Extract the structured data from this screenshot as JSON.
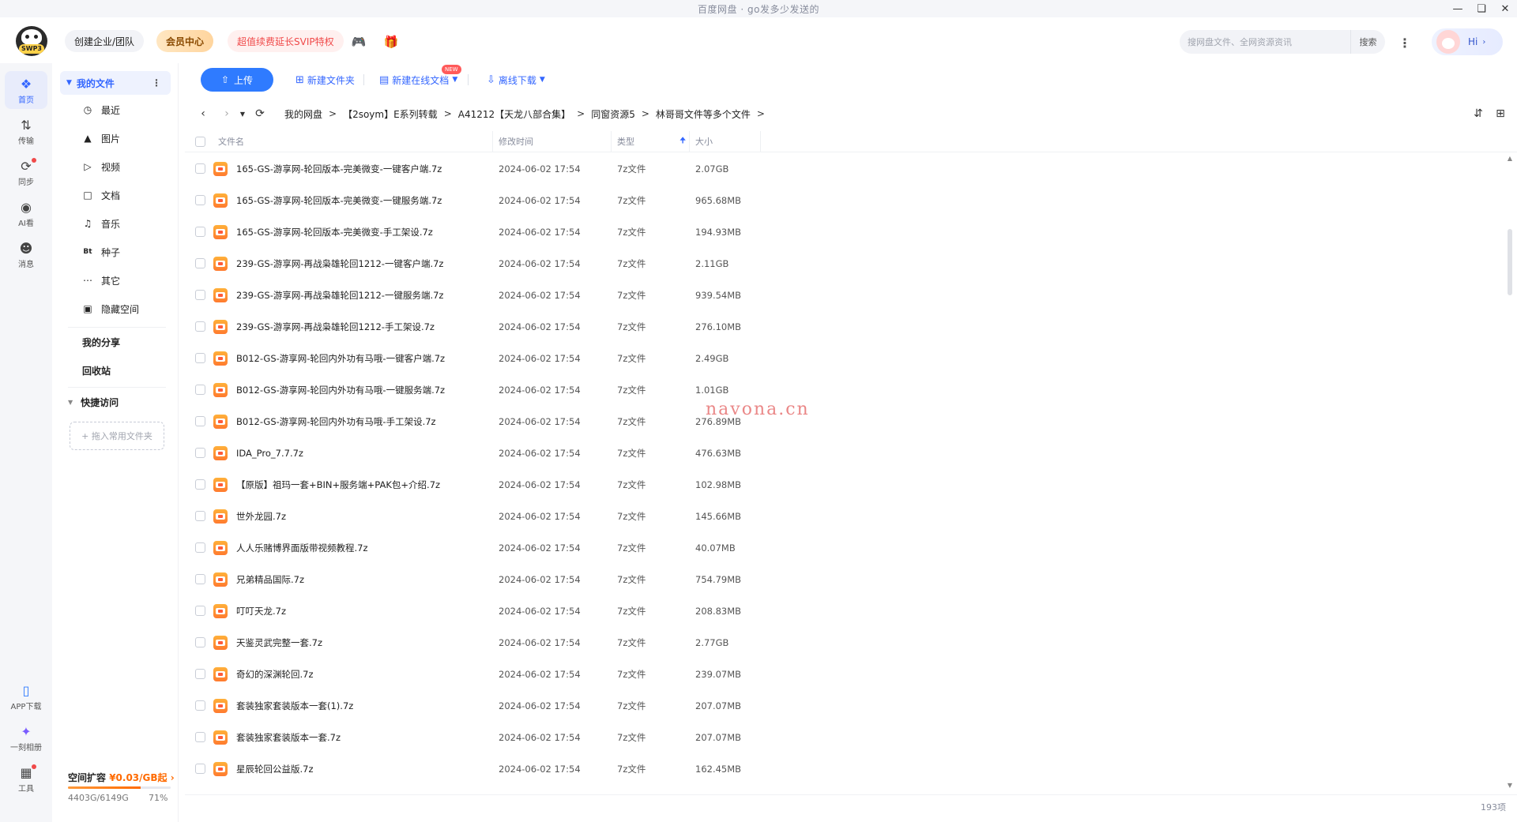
{
  "window": {
    "title": "百度网盘 · go发多少发送的"
  },
  "header": {
    "logo_text": "SWP3",
    "team_label": "创建企业/团队",
    "vip_label": "会员中心",
    "svip_label": "超值续费延长SVIP特权",
    "search_placeholder": "搜网盘文件、全网资源资讯",
    "search_label": "搜索",
    "greeting": "Hi"
  },
  "rail": {
    "items": [
      {
        "label": "首页",
        "icon": "home-icon"
      },
      {
        "label": "传输",
        "icon": "transfer-icon"
      },
      {
        "label": "同步",
        "icon": "sync-icon"
      },
      {
        "label": "AI看",
        "icon": "ai-icon"
      },
      {
        "label": "消息",
        "icon": "message-icon"
      }
    ],
    "bottom": [
      {
        "label": "APP下载",
        "icon": "phone-icon"
      },
      {
        "label": "一刻相册",
        "icon": "album-icon"
      },
      {
        "label": "工具",
        "icon": "tools-icon"
      }
    ]
  },
  "nav": {
    "my_files": "我的文件",
    "sub_items": [
      {
        "label": "最近",
        "icon": "clock-icon"
      },
      {
        "label": "图片",
        "icon": "image-icon"
      },
      {
        "label": "视频",
        "icon": "video-icon"
      },
      {
        "label": "文档",
        "icon": "document-icon"
      },
      {
        "label": "音乐",
        "icon": "music-icon"
      },
      {
        "label": "种子",
        "icon": "bt-icon"
      },
      {
        "label": "其它",
        "icon": "other-icon"
      },
      {
        "label": "隐藏空间",
        "icon": "lock-icon"
      }
    ],
    "my_share": "我的分享",
    "recycle": "回收站",
    "quick_access": "快捷访问",
    "drop_hint": "+ 拖入常用文件夹",
    "storage": {
      "title": "空间扩容",
      "price": "¥0.03/GB起",
      "used": "4403G/6149G",
      "percent_label": "71%",
      "percent": 71
    }
  },
  "toolbar": {
    "upload": "上传",
    "new_folder": "新建文件夹",
    "new_doc": "新建在线文档",
    "new_badge": "NEW",
    "offline": "离线下载"
  },
  "breadcrumb": [
    "我的网盘",
    "【2soym】E系列转载",
    "A41212【天龙八部合集】",
    "同窗资源5",
    "林哥哥文件等多个文件"
  ],
  "table": {
    "headers": {
      "name": "文件名",
      "time": "修改时间",
      "type": "类型",
      "size": "大小"
    },
    "rows": [
      {
        "name": "165-GS-游享网-轮回版本-完美微变-一键客户端.7z",
        "time": "2024-06-02 17:54",
        "type": "7z文件",
        "size": "2.07GB"
      },
      {
        "name": "165-GS-游享网-轮回版本-完美微变-一键服务端.7z",
        "time": "2024-06-02 17:54",
        "type": "7z文件",
        "size": "965.68MB"
      },
      {
        "name": "165-GS-游享网-轮回版本-完美微变-手工架设.7z",
        "time": "2024-06-02 17:54",
        "type": "7z文件",
        "size": "194.93MB"
      },
      {
        "name": "239-GS-游享网-再战枭雄轮回1212-一键客户端.7z",
        "time": "2024-06-02 17:54",
        "type": "7z文件",
        "size": "2.11GB"
      },
      {
        "name": "239-GS-游享网-再战枭雄轮回1212-一键服务端.7z",
        "time": "2024-06-02 17:54",
        "type": "7z文件",
        "size": "939.54MB"
      },
      {
        "name": "239-GS-游享网-再战枭雄轮回1212-手工架设.7z",
        "time": "2024-06-02 17:54",
        "type": "7z文件",
        "size": "276.10MB"
      },
      {
        "name": "B012-GS-游享网-轮回内外功有马哦-一键客户端.7z",
        "time": "2024-06-02 17:54",
        "type": "7z文件",
        "size": "2.49GB"
      },
      {
        "name": "B012-GS-游享网-轮回内外功有马哦-一键服务端.7z",
        "time": "2024-06-02 17:54",
        "type": "7z文件",
        "size": "1.01GB"
      },
      {
        "name": "B012-GS-游享网-轮回内外功有马哦-手工架设.7z",
        "time": "2024-06-02 17:54",
        "type": "7z文件",
        "size": "276.89MB"
      },
      {
        "name": "IDA_Pro_7.7.7z",
        "time": "2024-06-02 17:54",
        "type": "7z文件",
        "size": "476.63MB"
      },
      {
        "name": "【原版】祖玛一套+BIN+服务端+PAK包+介绍.7z",
        "time": "2024-06-02 17:54",
        "type": "7z文件",
        "size": "102.98MB"
      },
      {
        "name": "世外龙园.7z",
        "time": "2024-06-02 17:54",
        "type": "7z文件",
        "size": "145.66MB"
      },
      {
        "name": "人人乐赌博界面版带视频教程.7z",
        "time": "2024-06-02 17:54",
        "type": "7z文件",
        "size": "40.07MB"
      },
      {
        "name": "兄弟精品国际.7z",
        "time": "2024-06-02 17:54",
        "type": "7z文件",
        "size": "754.79MB"
      },
      {
        "name": "叮叮天龙.7z",
        "time": "2024-06-02 17:54",
        "type": "7z文件",
        "size": "208.83MB"
      },
      {
        "name": "天鉴灵武完整一套.7z",
        "time": "2024-06-02 17:54",
        "type": "7z文件",
        "size": "2.77GB"
      },
      {
        "name": "奇幻的深渊轮回.7z",
        "time": "2024-06-02 17:54",
        "type": "7z文件",
        "size": "239.07MB"
      },
      {
        "name": "套装独家套装版本一套(1).7z",
        "time": "2024-06-02 17:54",
        "type": "7z文件",
        "size": "207.07MB"
      },
      {
        "name": "套装独家套装版本一套.7z",
        "time": "2024-06-02 17:54",
        "type": "7z文件",
        "size": "207.07MB"
      },
      {
        "name": "星辰轮回公益版.7z",
        "time": "2024-06-02 17:54",
        "type": "7z文件",
        "size": "162.45MB"
      }
    ]
  },
  "footer": {
    "count": "193项"
  },
  "watermark": "navona.cn",
  "colors": {
    "accent": "#3366ff",
    "upload_bg": "#2f7bff",
    "svip_text": "#f04a4a",
    "price": "#ff6a00"
  }
}
